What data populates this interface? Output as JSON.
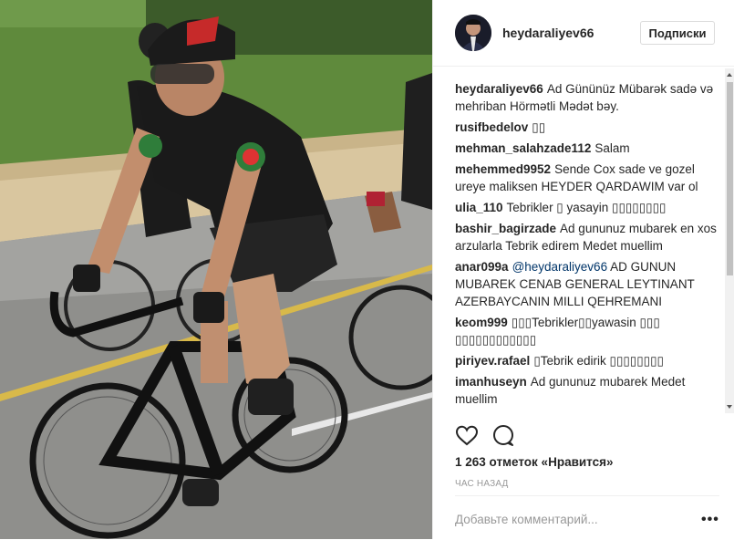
{
  "post": {
    "username": "heydaraliyev66",
    "follow_label": "Подписки"
  },
  "comments": [
    {
      "user": "heydaraliyev66",
      "text": "Ad Gününüz Mübarək sadə və mehriban Hörmətli Mədət bəy."
    },
    {
      "user": "rusifbedelov",
      "text": "▯▯"
    },
    {
      "user": "mehman_salahzade112",
      "text": "Salam"
    },
    {
      "user": "mehemmed9952",
      "text": "Sende Cox sade ve gozel ureye maliksen HEYDER QARDAWIM var ol"
    },
    {
      "user": "ulia_110",
      "text": "Tebrikler ▯ yasayin ▯▯▯▯▯▯▯▯"
    },
    {
      "user": "bashir_bagirzade",
      "text": "Ad gununuz mubarek en xos arzularla Tebrik edirem Medet muellim"
    },
    {
      "user": "anar099a",
      "mention": "@heydaraliyev66",
      "text": "AD GUNUN MUBAREK CENAB GENERAL LEYTINANT AZERBAYCANIN MILLI QEHREMANI"
    },
    {
      "user": "keom999",
      "text": "▯▯▯Tebrikler▯▯yawasin ▯▯▯ ▯▯▯▯▯▯▯▯▯▯▯▯"
    },
    {
      "user": "piriyev.rafael",
      "text": "▯Tebrik edirik ▯▯▯▯▯▯▯▯"
    },
    {
      "user": "imanhuseyn",
      "text": "Ad gununuz mubarek Medet muellim"
    }
  ],
  "likes_text": "1 263 отметок «Нравится»",
  "time_ago": "час назад",
  "add_comment_placeholder": "Добавьте комментарий...",
  "more_label": "•••",
  "icons": {
    "like": "heart-icon",
    "comment": "comment-icon",
    "more": "more-options-icon"
  }
}
